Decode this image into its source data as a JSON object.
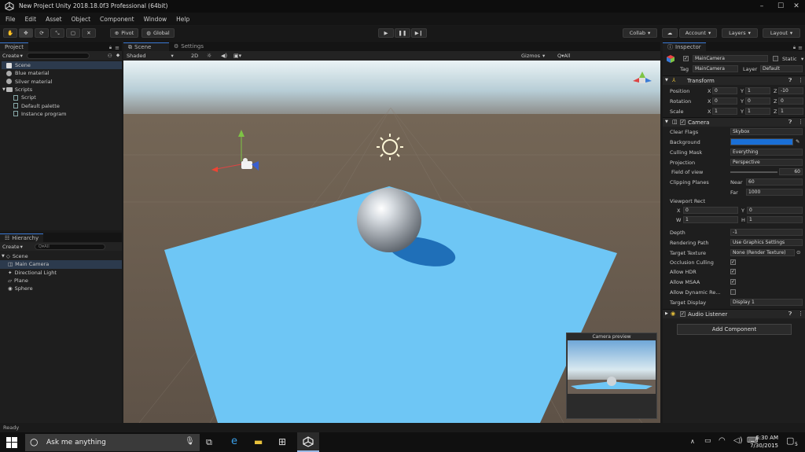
{
  "window": {
    "title": "New Project  Unity 2018.18.0f3 Professional (64bit)"
  },
  "menu": [
    "File",
    "Edit",
    "Asset",
    "Object",
    "Component",
    "Window",
    "Help"
  ],
  "toolbar": {
    "pivot": "Pivot",
    "global": "Global",
    "collab": "Collab",
    "account": "Account",
    "layers": "Layers",
    "layout": "Layout"
  },
  "project": {
    "tab": "Project",
    "create": "Create",
    "items": [
      {
        "label": "Scene",
        "icon": "unity-scene-icon",
        "selected": true
      },
      {
        "label": "Blue material",
        "icon": "material-icon"
      },
      {
        "label": "Silver material",
        "icon": "material-icon"
      },
      {
        "label": "Scripts",
        "icon": "folder-icon"
      },
      {
        "label": "Script",
        "icon": "script-icon"
      },
      {
        "label": "Default palette",
        "icon": "script-icon"
      },
      {
        "label": "Instance program",
        "icon": "script-icon"
      }
    ]
  },
  "hierarchy": {
    "tab": "Hierarchy",
    "create": "Create",
    "search_placeholder": "Q▾All",
    "items": [
      {
        "label": "Scene",
        "level": 0
      },
      {
        "label": "Main Camera",
        "level": 1,
        "selected": true
      },
      {
        "label": "Directional Light",
        "level": 1
      },
      {
        "label": "Plane",
        "level": 1
      },
      {
        "label": "Sphere",
        "level": 1
      }
    ]
  },
  "scene": {
    "tab_scene": "Scene",
    "tab_settings": "Settings",
    "shading": "Shaded",
    "mode2d": "2D",
    "gizmos": "Gizmos",
    "search": "Q▾All",
    "camera_preview_label": "Camera preview"
  },
  "inspector": {
    "tab": "Inspector",
    "object_name": "MainCamera",
    "static_label": "Static",
    "tag_label": "Tag",
    "tag_value": "MainCamera",
    "layer_label": "Layer",
    "layer_value": "Default",
    "transform": {
      "title": "Transform",
      "position": {
        "label": "Position",
        "x": "0",
        "y": "1",
        "z": "-10"
      },
      "rotation": {
        "label": "Rotation",
        "x": "0",
        "y": "0",
        "z": "0"
      },
      "scale": {
        "label": "Scale",
        "x": "1",
        "y": "1",
        "z": "1"
      }
    },
    "camera": {
      "title": "Camera",
      "clear_flags": {
        "label": "Clear Flags",
        "value": "Skybox"
      },
      "background": {
        "label": "Background",
        "color": "#1a6fd6"
      },
      "culling_mask": {
        "label": "Culling Mask",
        "value": "Everything"
      },
      "projection": {
        "label": "Projection",
        "value": "Perspective"
      },
      "fov": {
        "label": "Field of view",
        "value": "60"
      },
      "clipping": {
        "label": "Clipping Planes",
        "near_label": "Near",
        "near": "60",
        "far_label": "Far",
        "far": "1000"
      },
      "viewport": {
        "label": "Viewport Rect",
        "x": "0",
        "y": "0",
        "w": "1",
        "h": "1"
      },
      "depth": {
        "label": "Depth",
        "value": "-1"
      },
      "rendering_path": {
        "label": "Rendering Path",
        "value": "Use Graphics Settings"
      },
      "target_texture": {
        "label": "Target Texture",
        "value": "None (Render Texture)"
      },
      "occlusion": {
        "label": "Occlusion Culling"
      },
      "hdr": {
        "label": "Allow HDR"
      },
      "msaa": {
        "label": "Allow MSAA"
      },
      "dynamic": {
        "label": "Allow Dynamic Re..."
      },
      "target_display": {
        "label": "Target Display",
        "value": "Display 1"
      }
    },
    "audio_listener": "Audio Listener",
    "add_component": "Add Component"
  },
  "status": {
    "text": "Ready"
  },
  "taskbar": {
    "search_placeholder": "Ask me anything",
    "time": "6:30 AM",
    "date": "7/30/2015",
    "notifications": "5"
  },
  "colors": {
    "accent": "#3d7bd6",
    "plane": "#6bc4f4",
    "sky": "#c9dde6",
    "ground": "#6c5e52"
  }
}
